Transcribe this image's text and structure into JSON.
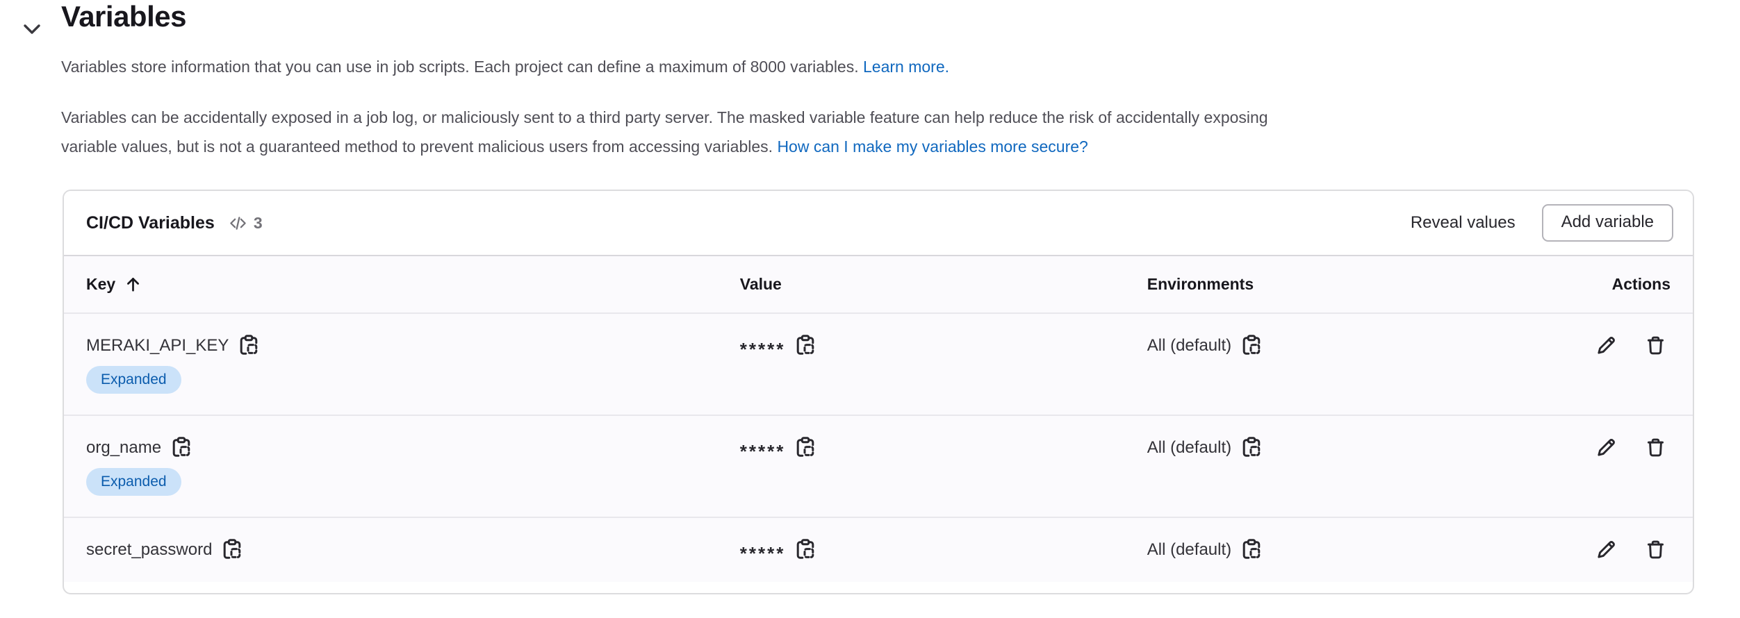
{
  "colors": {
    "link": "#1068bf",
    "badge_background": "#cbe2f9",
    "badge_text": "#0b5cad",
    "card_border": "#dcdcde",
    "table_background": "#fbfafd",
    "text_primary": "#18171d",
    "text_secondary": "#4f4e56",
    "icon": "#28272d"
  },
  "icons": {
    "section_toggle": "chevron-down-icon",
    "count": "code-icon",
    "sort": "arrow-up-icon",
    "copy": "copy-to-clipboard-icon",
    "edit": "pencil-icon",
    "delete": "remove-icon"
  },
  "section": {
    "title": "Variables",
    "intro": {
      "text": "Variables store information that you can use in job scripts. Each project can define a maximum of 8000 variables.",
      "link": "Learn more."
    },
    "warning": {
      "line1": "Variables can be accidentally exposed in a job log, or maliciously sent to a third party server. The masked variable feature can help reduce the risk of accidentally exposing",
      "line2": "variable values, but is not a guaranteed method to prevent malicious users from accessing variables.",
      "link": "How can I make my variables more secure?"
    }
  },
  "card": {
    "title": "CI/CD Variables",
    "count": "3",
    "reveal_values_label": "Reveal values",
    "add_variable_label": "Add variable"
  },
  "table": {
    "headers": {
      "key": "Key",
      "value": "Value",
      "environments": "Environments",
      "actions": "Actions"
    },
    "sort": "ascending",
    "rows": [
      {
        "key": "MERAKI_API_KEY",
        "badge": "Expanded",
        "value": "*****",
        "environments": "All (default)"
      },
      {
        "key": "org_name",
        "badge": "Expanded",
        "value": "*****",
        "environments": "All (default)"
      },
      {
        "key": "secret_password",
        "value": "*****",
        "environments": "All (default)"
      }
    ]
  }
}
